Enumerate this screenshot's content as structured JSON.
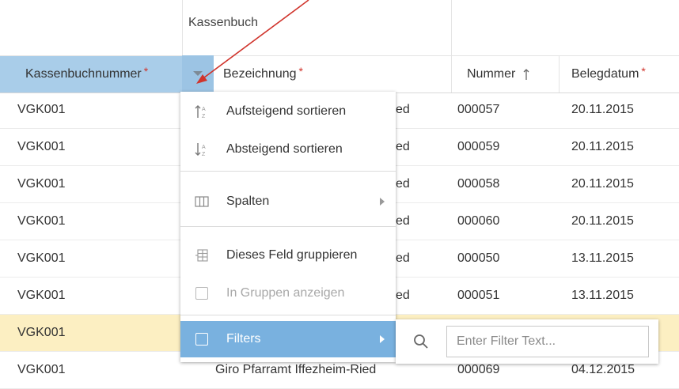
{
  "group_header": {
    "label": "Kassenbuch"
  },
  "columns": {
    "kassenbuchnummer": "Kassenbuchnummer",
    "bezeichnung": "Bezeichnung",
    "nummer": "Nummer",
    "nummer_sort_icon": "arrow-up-icon",
    "belegdatum": "Belegdatum",
    "required_mark": "*"
  },
  "rows": [
    {
      "kb": "VGK001",
      "bez": "ed",
      "num": "000057",
      "date": "20.11.2015"
    },
    {
      "kb": "VGK001",
      "bez": "ed",
      "num": "000059",
      "date": "20.11.2015"
    },
    {
      "kb": "VGK001",
      "bez": "ed",
      "num": "000058",
      "date": "20.11.2015"
    },
    {
      "kb": "VGK001",
      "bez": "ed",
      "num": "000060",
      "date": "20.11.2015"
    },
    {
      "kb": "VGK001",
      "bez": "ed",
      "num": "000050",
      "date": "13.11.2015"
    },
    {
      "kb": "VGK001",
      "bez": "ed",
      "num": "000051",
      "date": "13.11.2015"
    },
    {
      "kb": "VGK001",
      "bez": "",
      "num": "",
      "date": "",
      "selected": true
    },
    {
      "kb": "VGK001",
      "bez": "Giro Pfarramt Iffezheim-Ried",
      "num": "000069",
      "date": "04.12.2015"
    }
  ],
  "menu": {
    "sort_asc": "Aufsteigend sortieren",
    "sort_desc": "Absteigend sortieren",
    "columns": "Spalten",
    "group_field": "Dieses Feld gruppieren",
    "show_in_groups": "In Gruppen anzeigen",
    "filters": "Filters"
  },
  "filter": {
    "placeholder": "Enter Filter Text..."
  },
  "colors": {
    "accent": "#79b1df",
    "header_active": "#a9cde9",
    "selected_row": "#fcefc2",
    "annotation_arrow": "#d0342c"
  }
}
